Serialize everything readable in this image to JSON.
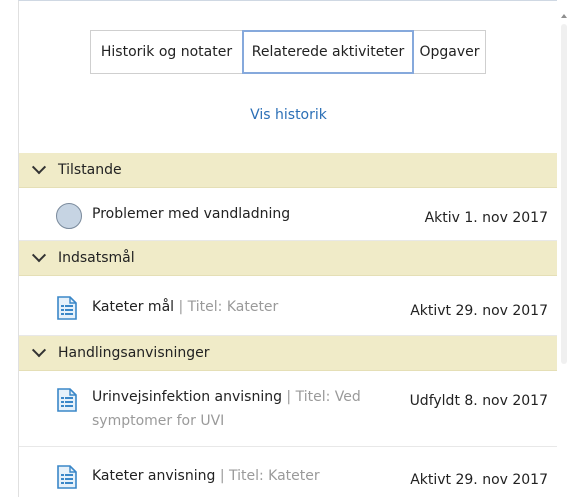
{
  "tabs": [
    {
      "label": "Historik og notater"
    },
    {
      "label": "Relaterede aktiviteter"
    },
    {
      "label": "Opgaver"
    }
  ],
  "vis_historik": "Vis historik",
  "sections": [
    {
      "title": "Tilstande",
      "items": [
        {
          "title": "Problemer med vandladning",
          "date": "Aktiv 1. nov 2017",
          "icon": "circle-condition-icon"
        }
      ]
    },
    {
      "title": "Indsatsmål",
      "items": [
        {
          "title": "Kateter mål",
          "separator": " | ",
          "meta": "Titel: Kateter",
          "date": "Aktivt 29. nov 2017",
          "icon": "document-icon"
        }
      ]
    },
    {
      "title": "Handlingsanvisninger",
      "items": [
        {
          "title": "Urinvejsinfektion anvisning",
          "separator": " | ",
          "meta": "Titel: Ved",
          "meta_line2": "symptomer for UVI",
          "date": "Udfyldt 8. nov 2017",
          "icon": "document-icon"
        },
        {
          "title": "Kateter anvisning",
          "separator": " | ",
          "meta": "Titel: Kateter",
          "date": "Aktivt 29. nov 2017",
          "icon": "document-icon"
        }
      ]
    }
  ],
  "colors": {
    "section_bg": "#f0ebc8",
    "link": "#2b6fb6",
    "active_tab_border": "#86a9dc",
    "meta_text": "#9a9a9a"
  }
}
